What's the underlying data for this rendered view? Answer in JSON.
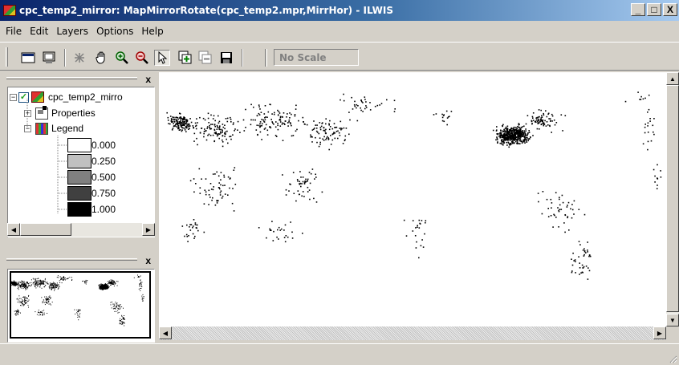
{
  "window": {
    "title": "cpc_temp2_mirror: MapMirrorRotate(cpc_temp2.mpr,MirrHor) - ILWIS",
    "buttons": {
      "minimize": "_",
      "maximize": "□",
      "close": "X"
    }
  },
  "menu": [
    "File",
    "Edit",
    "Layers",
    "Options",
    "Help"
  ],
  "toolbar": {
    "scale_text": "No Scale",
    "tools": [
      "entire-map-icon",
      "map-window-icon",
      "normal-cursor-icon",
      "pan-icon",
      "zoom-in-icon",
      "zoom-out-icon",
      "select-arrow-icon",
      "add-layer-icon",
      "remove-layer-icon",
      "save-icon"
    ]
  },
  "layers_panel": {
    "close_label": "x",
    "layer_name": "cpc_temp2_mirro",
    "properties_label": "Properties",
    "legend_label": "Legend",
    "legend": [
      {
        "value": "0.000",
        "color": "#ffffff"
      },
      {
        "value": "0.250",
        "color": "#c0c0c0"
      },
      {
        "value": "0.500",
        "color": "#808080"
      },
      {
        "value": "0.750",
        "color": "#404040"
      },
      {
        "value": "1.000",
        "color": "#000000"
      }
    ]
  },
  "overview_panel": {
    "close_label": "x"
  },
  "colors": {
    "title_start": "#0a246a",
    "title_end": "#a6caf0",
    "face": "#d4d0c8",
    "points": "#000000"
  }
}
